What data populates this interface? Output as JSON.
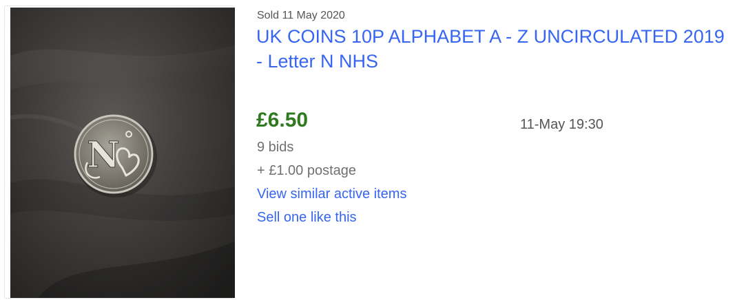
{
  "listing": {
    "image_alt": "Coin photo: letter N NHS 10p coin on dark fabric",
    "coin_letter": "N",
    "sold_date": "Sold 11 May 2020",
    "title": "UK COINS 10P ALPHABET A - Z UNCIRCULATED 2019 - Letter N NHS",
    "price": "£6.50",
    "end_time": "11-May 19:30",
    "bids": "9 bids",
    "postage": "+ £1.00 postage",
    "view_similar_label": "View similar active items",
    "sell_one_label": "Sell one like this"
  },
  "colors": {
    "link": "#3665f3",
    "price": "#2f7a1f",
    "muted": "#707070"
  }
}
